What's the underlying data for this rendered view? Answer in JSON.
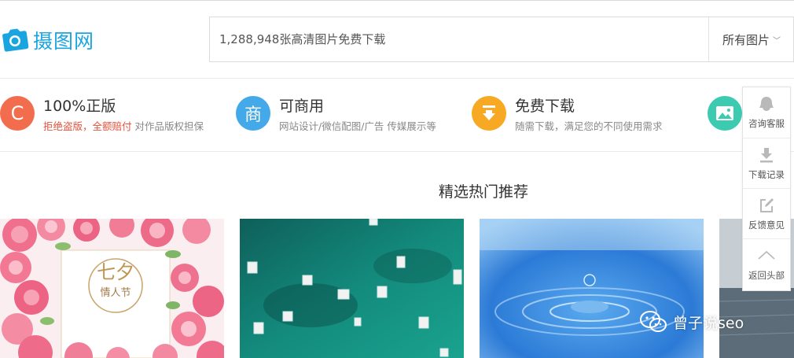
{
  "header": {
    "logo_text": "摄图网",
    "search": {
      "placeholder": "1,288,948张高清图片免费下载",
      "category": "所有图片",
      "category_chevron": "﹀"
    }
  },
  "features": [
    {
      "icon_char": "C",
      "icon": "copyright-badge-icon",
      "color": "#f26d4e",
      "title": "100%正版",
      "desc_highlight": "拒绝盗版，全额赔付",
      "desc": " 对作品版权担保"
    },
    {
      "icon_char": "商",
      "icon": "commercial-badge-icon",
      "color": "#44a9e8",
      "title": "可商用",
      "desc": "网站设计/微信配图/广告 传媒展示等"
    },
    {
      "icon_char": "↓",
      "icon": "download-badge-icon",
      "color": "#f7a923",
      "title": "免费下载",
      "desc": "随需下载，满足您的不同使用需求"
    },
    {
      "icon": "image-badge-icon",
      "color": "#3ccbb1"
    }
  ],
  "section_title": "精选热门推荐",
  "gallery": [
    {
      "name": "qixi-roses-card",
      "text_main": "七夕",
      "text_sub": "情人节"
    },
    {
      "name": "boats-on-sea"
    },
    {
      "name": "water-drop-splash"
    },
    {
      "name": "seascape"
    }
  ],
  "sidebar": [
    {
      "label": "咨询客服",
      "icon": "chat-service-icon"
    },
    {
      "label": "下载记录",
      "icon": "download-icon"
    },
    {
      "label": "反馈意见",
      "icon": "edit-feedback-icon"
    },
    {
      "label": "返回头部",
      "icon": "chevron-up-icon"
    }
  ],
  "watermark": "曾子说seo",
  "colors": {
    "brand": "#1aa5e0",
    "orange": "#f26d4e",
    "blue": "#44a9e8",
    "yellow": "#f7a923",
    "teal": "#3ccbb1",
    "highlight": "#e2523c"
  }
}
